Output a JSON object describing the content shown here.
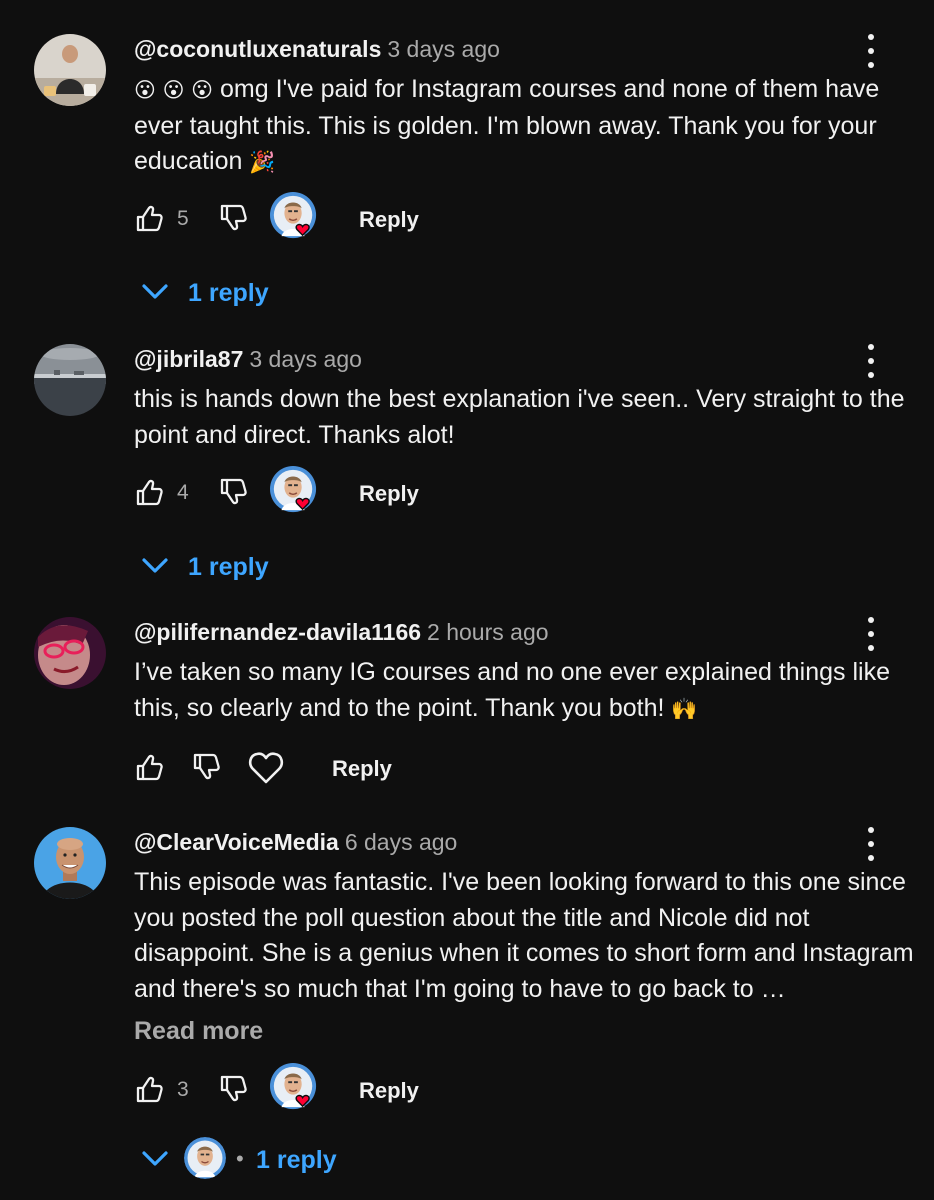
{
  "comments": [
    {
      "author": "@coconutluxenaturals",
      "time": "3 days ago",
      "emoji_prefix": "😮 😮 😮",
      "text": "omg I've paid for Instagram courses and none of them have ever taught this. This is golden.  I'm blown away. Thank you for your education",
      "emoji_suffix": "🎉",
      "likes": "5",
      "reply_label": "Reply",
      "replies_label": "1 reply",
      "creator_hearted": true
    },
    {
      "author": "@jibrila87",
      "time": "3 days ago",
      "text": "this is hands down the best explanation i've seen.. Very straight to the point and direct. Thanks alot!",
      "likes": "4",
      "reply_label": "Reply",
      "replies_label": "1 reply",
      "creator_hearted": true
    },
    {
      "author": "@pilifernandez-davila1166",
      "time": "2 hours ago",
      "text": "I’ve taken so many IG courses and no one ever explained things like this, so clearly and to the point. Thank you both!",
      "emoji_suffix": "🙌",
      "likes": "",
      "reply_label": "Reply",
      "creator_hearted": false
    },
    {
      "author": "@ClearVoiceMedia",
      "time": "6 days ago",
      "text": "This episode was fantastic. I've been looking forward to this one since you posted the poll question about the title and Nicole did not disappoint. She is a genius when it comes to short form and Instagram and there's so much that I'm going to have to go back to …",
      "read_more": "Read more",
      "likes": "3",
      "reply_label": "Reply",
      "replies_label": "1 reply",
      "replies_separator": "•",
      "creator_hearted": true
    }
  ],
  "icons": {
    "like": "thumbs-up-icon",
    "dislike": "thumbs-down-icon",
    "heart": "heart-outline-icon",
    "menu": "more-vertical-icon",
    "expand": "chevron-down-icon"
  },
  "colors": {
    "background": "#0f0f0f",
    "text": "#f1f1f1",
    "secondary": "#aaaaaa",
    "link": "#3ea6ff",
    "heart": "#ff0033"
  }
}
